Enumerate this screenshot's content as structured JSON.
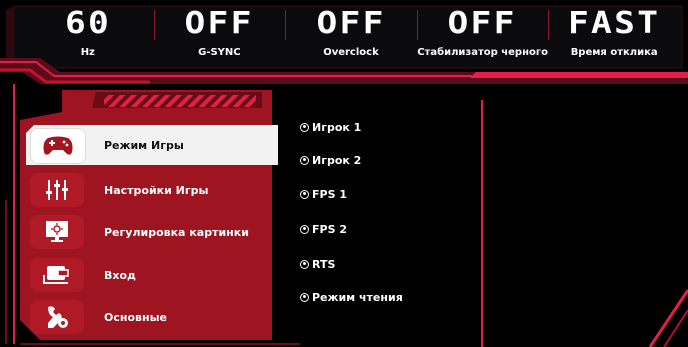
{
  "status_bar": [
    {
      "value": "60",
      "label": "Hz"
    },
    {
      "value": "OFF",
      "label": "G-SYNC"
    },
    {
      "value": "OFF",
      "label": "Overclock"
    },
    {
      "value": "OFF",
      "label": "Стабилизатор черного"
    },
    {
      "value": "FAST",
      "label": "Время отклика"
    }
  ],
  "menu": {
    "active_index": 0,
    "items": [
      {
        "label": "Режим Игры",
        "icon": "gamepad-icon"
      },
      {
        "label": "Настройки Игры",
        "icon": "sliders-icon"
      },
      {
        "label": "Регулировка картинки",
        "icon": "picture-adjust-icon"
      },
      {
        "label": "Вход",
        "icon": "input-source-icon"
      },
      {
        "label": "Основные",
        "icon": "wrench-gear-icon"
      }
    ]
  },
  "options": [
    {
      "label": "Игрок 1"
    },
    {
      "label": "Игрок 2"
    },
    {
      "label": "FPS 1"
    },
    {
      "label": "FPS 2"
    },
    {
      "label": "RTS"
    },
    {
      "label": "Режим чтения"
    }
  ],
  "colors": {
    "accent_red": "#c8102e",
    "panel_red": "#9e1420",
    "pink_line": "#e0204a",
    "active_bg": "#f2f2f2"
  }
}
